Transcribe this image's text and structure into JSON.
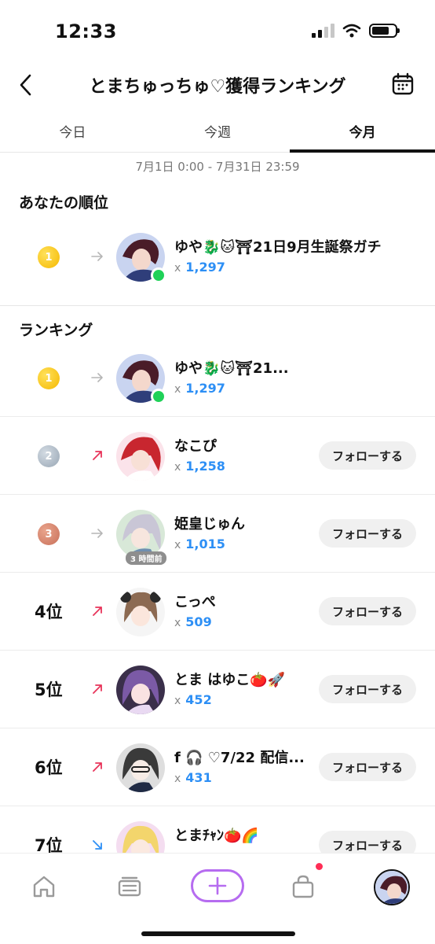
{
  "status_bar": {
    "time": "12:33"
  },
  "header": {
    "title": "とまちゅっちゅ♡獲得ランキング",
    "back_icon": "chevron-left-icon",
    "calendar_icon": "calendar-icon"
  },
  "tabs": [
    {
      "label": "今日",
      "active": false
    },
    {
      "label": "今週",
      "active": false
    },
    {
      "label": "今月",
      "active": true
    }
  ],
  "period": "7月1日 0:00 - 7月31日 23:59",
  "my_rank": {
    "section_title": "あなたの順位",
    "rank": "1",
    "trend": "flat",
    "name": "ゆや🐉🐱⛩21日9月生誕祭ガチ",
    "x_label": "x",
    "count": "1,297",
    "online": true
  },
  "ranking": {
    "section_title": "ランキング",
    "follow_label": "フォローする",
    "rows": [
      {
        "rank": "1",
        "medal": "gold",
        "trend": "flat",
        "name": "ゆや🐉🐱⛩21...",
        "count": "1,297",
        "online": true,
        "follow": false
      },
      {
        "rank": "2",
        "medal": "silver",
        "trend": "up",
        "name": "なこぴ",
        "count": "1,258",
        "follow": true
      },
      {
        "rank": "3",
        "medal": "bronze",
        "trend": "flat",
        "name": "姫皇じゅん",
        "count": "1,015",
        "badge": "3 時間前",
        "follow": true
      },
      {
        "rank": "4位",
        "trend": "up",
        "name": "こっぺ",
        "count": "509",
        "follow": true
      },
      {
        "rank": "5位",
        "trend": "up",
        "name": "とま はゆこ🍅🚀",
        "count": "452",
        "follow": true
      },
      {
        "rank": "6位",
        "trend": "up",
        "name": "f 🎧 ♡7/22 配信...",
        "count": "431",
        "follow": true
      },
      {
        "rank": "7位",
        "trend": "down",
        "name": "とまﾁｬﾝ🍅🌈",
        "count": "",
        "follow": true
      }
    ]
  },
  "colors": {
    "accent_blue": "#2d8ff5",
    "trend_up": "#e8345a",
    "trend_down": "#2d8ff5",
    "online": "#1fd158",
    "plus_border": "#b66cf0"
  },
  "bottom_nav": [
    "home-icon",
    "feed-icon",
    "plus-icon",
    "shop-icon",
    "profile-avatar"
  ]
}
